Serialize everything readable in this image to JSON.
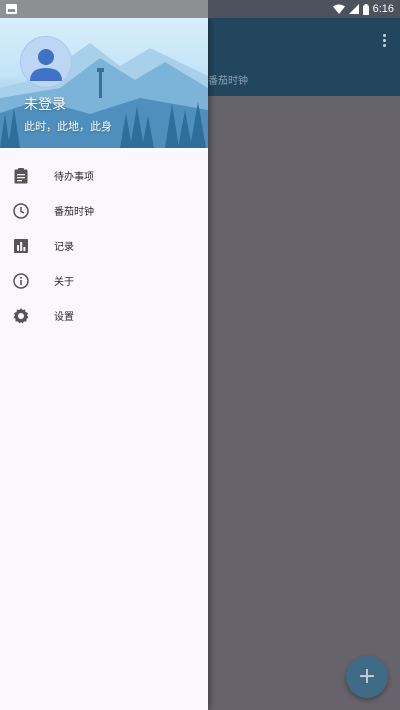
{
  "status_bar": {
    "time": "6:16",
    "icons": [
      "notification-icon",
      "wifi-icon",
      "signal-icon",
      "battery-icon"
    ]
  },
  "drawer": {
    "header": {
      "username": "未登录",
      "subtitle": "此时，此地，此身"
    },
    "items": [
      {
        "label": "待办事项",
        "icon": "clipboard-icon"
      },
      {
        "label": "番茄时钟",
        "icon": "clock-icon"
      },
      {
        "label": "记录",
        "icon": "bar-chart-icon"
      },
      {
        "label": "关于",
        "icon": "info-icon"
      },
      {
        "label": "设置",
        "icon": "gear-icon"
      }
    ]
  },
  "app": {
    "toolbar_title": "番茄时钟",
    "fab_label": "+"
  },
  "colors": {
    "toolbar": "#23465f",
    "scrim": "#66646a",
    "fab": "#3f6b87",
    "drawer_bg": "#fbf8fd"
  }
}
